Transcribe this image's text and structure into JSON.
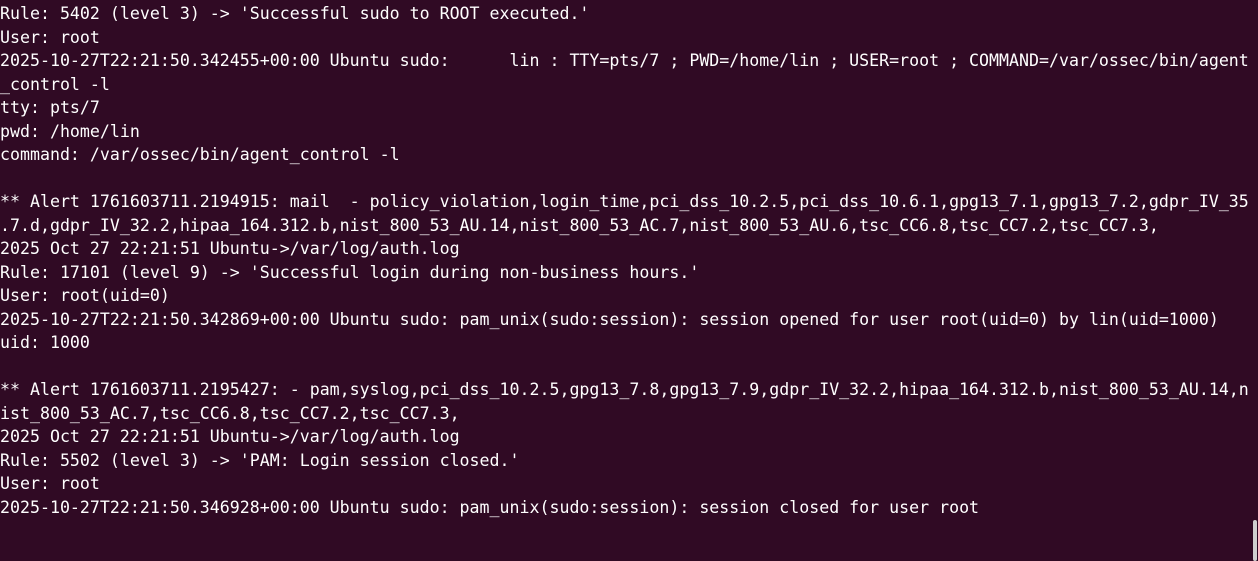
{
  "terminal": {
    "lines": [
      "Rule: 5402 (level 3) -> 'Successful sudo to ROOT executed.'",
      "User: root",
      "2025-10-27T22:21:50.342455+00:00 Ubuntu sudo:      lin : TTY=pts/7 ; PWD=/home/lin ; USER=root ; COMMAND=/var/ossec/bin/agent",
      "_control -l",
      "tty: pts/7",
      "pwd: /home/lin",
      "command: /var/ossec/bin/agent_control -l",
      "",
      "** Alert 1761603711.2194915: mail  - policy_violation,login_time,pci_dss_10.2.5,pci_dss_10.6.1,gpg13_7.1,gpg13_7.2,gdpr_IV_35",
      ".7.d,gdpr_IV_32.2,hipaa_164.312.b,nist_800_53_AU.14,nist_800_53_AC.7,nist_800_53_AU.6,tsc_CC6.8,tsc_CC7.2,tsc_CC7.3,",
      "2025 Oct 27 22:21:51 Ubuntu->/var/log/auth.log",
      "Rule: 17101 (level 9) -> 'Successful login during non-business hours.'",
      "User: root(uid=0)",
      "2025-10-27T22:21:50.342869+00:00 Ubuntu sudo: pam_unix(sudo:session): session opened for user root(uid=0) by lin(uid=1000)",
      "uid: 1000",
      "",
      "** Alert 1761603711.2195427: - pam,syslog,pci_dss_10.2.5,gpg13_7.8,gpg13_7.9,gdpr_IV_32.2,hipaa_164.312.b,nist_800_53_AU.14,n",
      "ist_800_53_AC.7,tsc_CC6.8,tsc_CC7.2,tsc_CC7.3,",
      "2025 Oct 27 22:21:51 Ubuntu->/var/log/auth.log",
      "Rule: 5502 (level 3) -> 'PAM: Login session closed.'",
      "User: root",
      "2025-10-27T22:21:50.346928+00:00 Ubuntu sudo: pam_unix(sudo:session): session closed for user root"
    ]
  },
  "colors": {
    "background": "#300a24",
    "foreground": "#ffffff",
    "scrollbar": "#cfcfcf"
  }
}
